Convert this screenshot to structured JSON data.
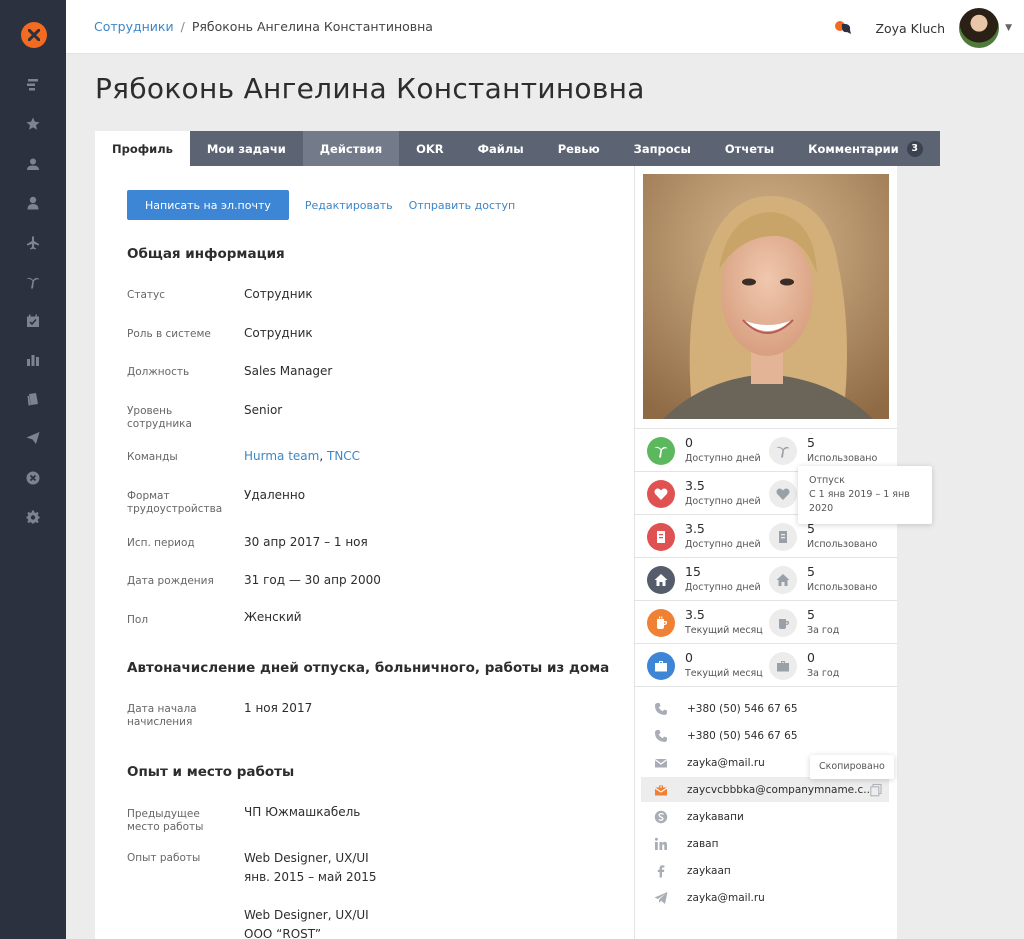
{
  "sidebar": {
    "logo": "hurma-logo",
    "items": [
      "feed-icon",
      "star-icon",
      "user-icon",
      "person-icon",
      "flight-icon",
      "palm-icon",
      "calendar-check-icon",
      "chart-bar-icon",
      "documents-icon",
      "send-icon",
      "circle-x-icon",
      "gear-icon"
    ]
  },
  "header": {
    "breadcrumb_link": "Сотрудники",
    "breadcrumb_sep": "/",
    "breadcrumb_current": "Рябоконь Ангелина Константиновна",
    "user_name": "Zoya Kluch"
  },
  "page": {
    "title": "Рябоконь Ангелина Константиновна"
  },
  "tabs": [
    {
      "label": "Профиль"
    },
    {
      "label": "Мои задачи"
    },
    {
      "label": "Действия"
    },
    {
      "label": "OKR"
    },
    {
      "label": "Файлы"
    },
    {
      "label": "Ревью"
    },
    {
      "label": "Запросы"
    },
    {
      "label": "Отчеты"
    },
    {
      "label": "Комментарии",
      "badge": "3"
    }
  ],
  "actions": {
    "email_button": "Написать на эл.почту",
    "edit_link": "Редактировать",
    "access_link": "Отправить  доступ"
  },
  "general": {
    "title": "Общая информация",
    "status_label": "Статус",
    "status_value": "Сотрудник",
    "role_label": "Роль в системе",
    "role_value": "Сотрудник",
    "position_label": "Должность",
    "position_value": "Sales Manager",
    "level_label": "Уровень сотрудника",
    "level_value": "Senior",
    "teams_label": "Команды",
    "team1": "Hurma team",
    "team_sep": ", ",
    "team2": "TNCC",
    "format_label": "Формат трудоустройства",
    "format_value": "Удаленно",
    "trial_label": "Исп. период",
    "trial_value": "30 апр 2017 – 1 ноя",
    "birth_label": "Дата рождения",
    "birth_value": "31 год — 30 апр 2000",
    "gender_label": "Пол",
    "gender_value": "Женский"
  },
  "accrual": {
    "title": "Автоначисление дней отпуска, больничного, работы из дома",
    "start_label": "Дата начала начисления",
    "start_value": "1 ноя 2017"
  },
  "experience": {
    "title": "Опыт и место работы",
    "prev_label": "Предыдущее место работы",
    "prev_value": "ЧП Южмашкабель",
    "exp_label": "Опыт работы",
    "exp1_title": "Web Designer, UX/UI",
    "exp1_dates": "янв. 2015 – май 2015",
    "exp2_title": "Web Designer, UX/UI",
    "exp2_company": "ООО “ROST”"
  },
  "stats": [
    {
      "icon": "palm-icon",
      "color": "#5bb85d",
      "left_num": "0",
      "left_cap": "Доступно дней",
      "right_icon": "palm-icon",
      "right_num": "5",
      "right_cap": "Использовано"
    },
    {
      "icon": "heart-pulse-icon",
      "color": "#e05152",
      "left_num": "3.5",
      "left_cap": "Доступно дней",
      "right_icon": "heart-pulse-icon",
      "right_num": "",
      "right_cap": ""
    },
    {
      "icon": "document-icon",
      "color": "#e05152",
      "left_num": "3.5",
      "left_cap": "Доступно дней",
      "right_icon": "document-icon",
      "right_num": "5",
      "right_cap": "Использовано"
    },
    {
      "icon": "home-icon",
      "color": "#555c6b",
      "left_num": "15",
      "left_cap": "Доступно дней",
      "right_icon": "home-icon",
      "right_num": "5",
      "right_cap": "Использовано"
    },
    {
      "icon": "cup-icon",
      "color": "#f08033",
      "left_num": "3.5",
      "left_cap": "Текущий месяц",
      "right_icon": "cup-icon",
      "right_num": "5",
      "right_cap": "За год"
    },
    {
      "icon": "briefcase-icon",
      "color": "#3d86d6",
      "left_num": "0",
      "left_cap": "Текущий месяц",
      "right_icon": "briefcase-icon",
      "right_num": "0",
      "right_cap": "За год"
    }
  ],
  "vacation_tooltip": {
    "title": "Отпуск",
    "dates": "С 1 янв 2019 – 1 янв 2020"
  },
  "contacts": [
    {
      "icon": "phone-icon",
      "text": "+380 (50) 546 67 65"
    },
    {
      "icon": "phone-icon",
      "text": "+380 (50) 546 67 65"
    },
    {
      "icon": "envelope-icon",
      "text": "zayka@mail.ru"
    },
    {
      "icon": "work-envelope-icon",
      "text": "zaycvcbbbka@companymname.c..."
    },
    {
      "icon": "skype-icon",
      "text": "zaykaвапи"
    },
    {
      "icon": "linkedin-icon",
      "text": "zавап"
    },
    {
      "icon": "facebook-icon",
      "text": "zaykaап"
    },
    {
      "icon": "telegram-icon",
      "text": "zayka@mail.ru"
    }
  ],
  "copied_tooltip": "Скопировано",
  "colors": {
    "sidebar": "#2c3140",
    "accent": "#3d86d6",
    "logo": "#f26b21",
    "tabs": "#5c6474"
  }
}
